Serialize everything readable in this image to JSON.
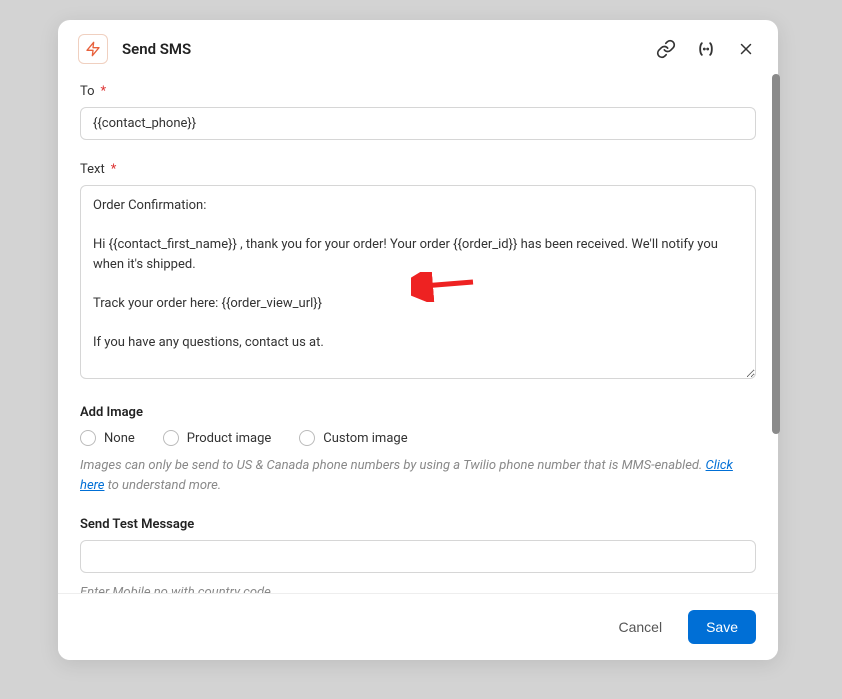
{
  "header": {
    "title": "Send SMS"
  },
  "fields": {
    "to": {
      "label": "To",
      "value": "{{contact_phone}}"
    },
    "text": {
      "label": "Text",
      "value": "Order Confirmation:\n\nHi {{contact_first_name}} , thank you for your order! Your order {{order_id}} has been received. We'll notify you when it's shipped.\n\nTrack your order here: {{order_view_url}}\n\nIf you have any questions, contact us at."
    },
    "addImage": {
      "label": "Add Image",
      "options": [
        "None",
        "Product image",
        "Custom image"
      ],
      "helpPrefix": "Images can only be send to US & Canada phone numbers by using a Twilio phone number that is MMS-enabled. ",
      "linkText": "Click here",
      "helpSuffix": " to understand more."
    },
    "sendTest": {
      "label": "Send Test Message",
      "value": "",
      "hint": "Enter Mobile no with country code"
    }
  },
  "footer": {
    "cancel": "Cancel",
    "save": "Save"
  }
}
